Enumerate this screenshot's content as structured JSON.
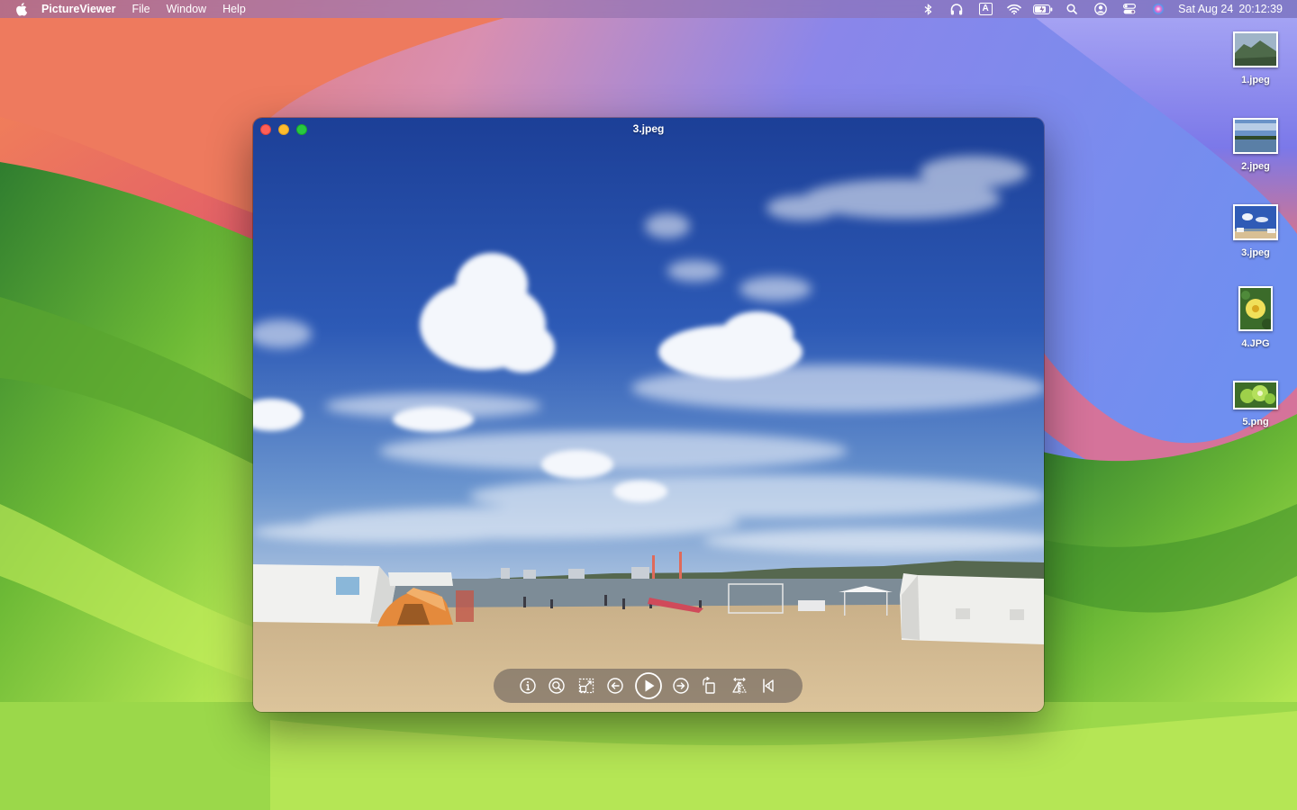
{
  "menubar": {
    "app_name": "PictureViewer",
    "menus": [
      "File",
      "Window",
      "Help"
    ],
    "status_icons": [
      "bluetooth-icon",
      "headphones-icon",
      "input-source-icon",
      "wifi-icon",
      "battery-icon",
      "spotlight-icon",
      "user-icon",
      "control-center-icon",
      "siri-icon"
    ],
    "input_source": "A",
    "date": "Sat Aug 24",
    "time": "20:12:39"
  },
  "desktop": {
    "files": [
      {
        "name": "1.jpeg",
        "thumb": "mountain"
      },
      {
        "name": "2.jpeg",
        "thumb": "lake"
      },
      {
        "name": "3.jpeg",
        "thumb": "beach"
      },
      {
        "name": "4.JPG",
        "thumb": "flower"
      },
      {
        "name": "5.png",
        "thumb": "fruit"
      }
    ]
  },
  "window": {
    "title": "3.jpeg",
    "toolbar": [
      "info-icon",
      "zoom-icon",
      "fit-icon",
      "previous-icon",
      "play-icon",
      "next-icon",
      "rotate-icon",
      "flip-icon",
      "first-image-icon"
    ]
  },
  "colors": {
    "close": "#fe5f57",
    "minimize": "#febc2e",
    "maximize": "#28c840",
    "sky": "#2d58b4",
    "sand": "#d8bf94"
  }
}
